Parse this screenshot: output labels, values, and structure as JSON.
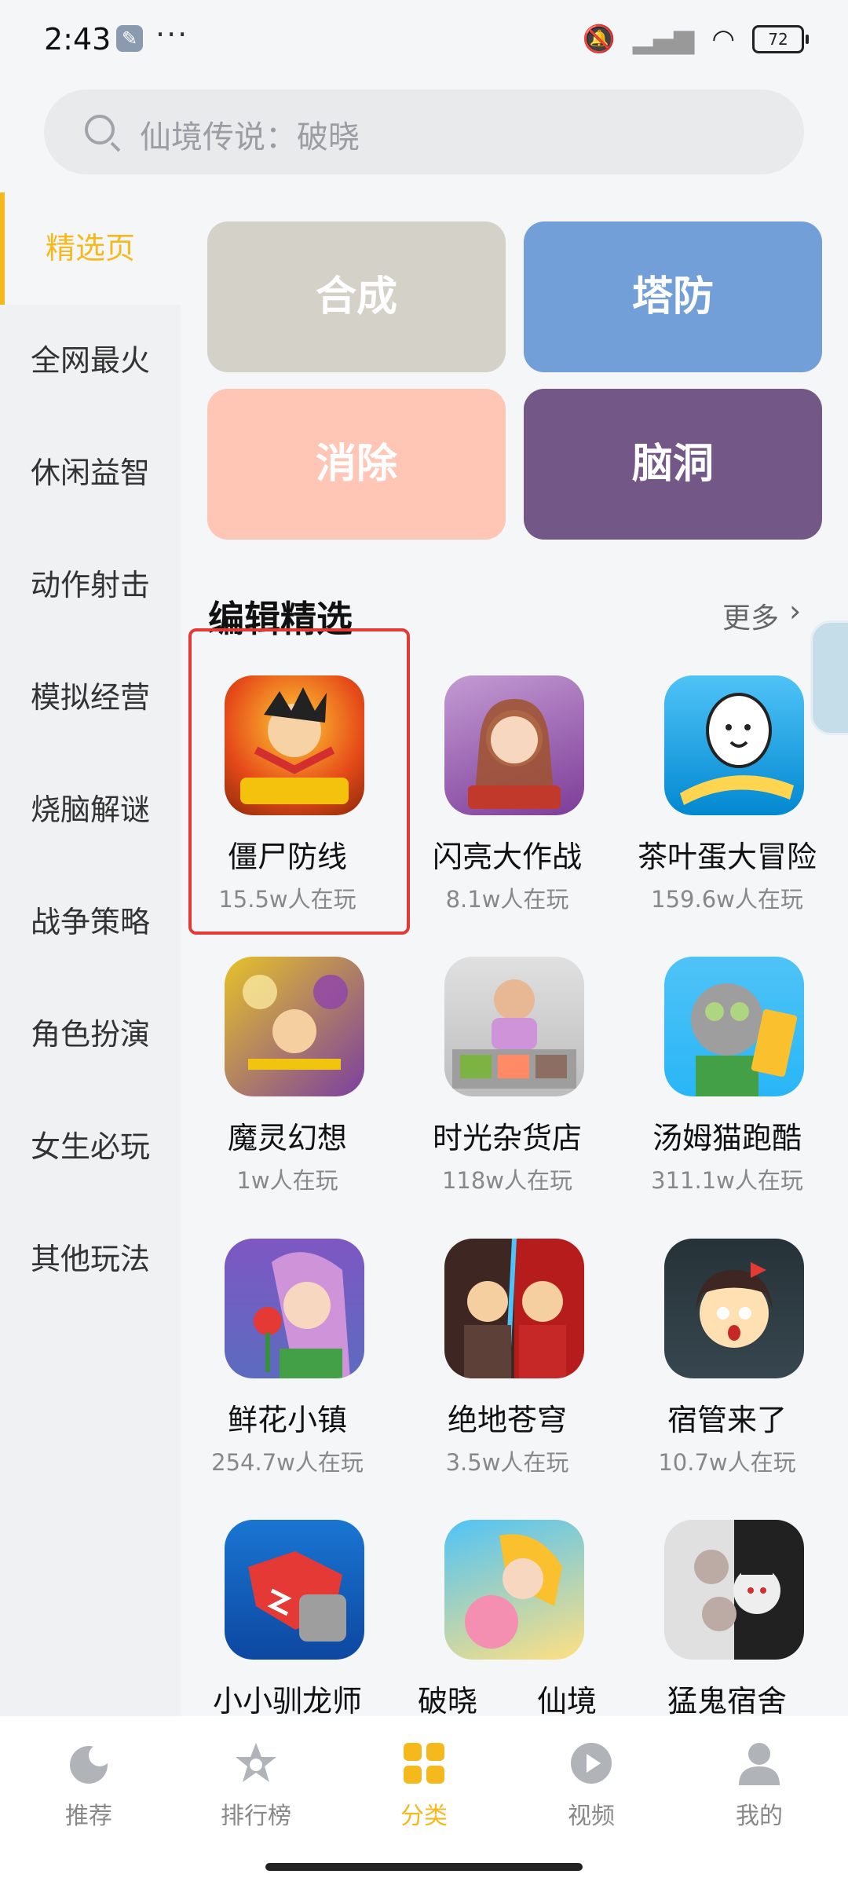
{
  "status": {
    "time": "2:43",
    "battery": "72"
  },
  "search": {
    "placeholder": "仙境传说：破晓"
  },
  "sidebar": {
    "items": [
      {
        "label": "精选页"
      },
      {
        "label": "全网最火"
      },
      {
        "label": "休闲益智"
      },
      {
        "label": "动作射击"
      },
      {
        "label": "模拟经营"
      },
      {
        "label": "烧脑解谜"
      },
      {
        "label": "战争策略"
      },
      {
        "label": "角色扮演"
      },
      {
        "label": "女生必玩"
      },
      {
        "label": "其他玩法"
      }
    ]
  },
  "categories": [
    {
      "label": "合成",
      "color": "#d4d1c8"
    },
    {
      "label": "塔防",
      "color": "#739fd8"
    },
    {
      "label": "消除",
      "color": "#ffc5b5"
    },
    {
      "label": "脑洞",
      "color": "#735887"
    }
  ],
  "section": {
    "title": "编辑精选",
    "more": "更多"
  },
  "games": [
    {
      "name": "僵尸防线",
      "players": "15.5w人在玩"
    },
    {
      "name": "闪亮大作战",
      "players": "8.1w人在玩"
    },
    {
      "name": "茶叶蛋大冒险",
      "players": "159.6w人在玩"
    },
    {
      "name": "魔灵幻想",
      "players": "1w人在玩"
    },
    {
      "name": "时光杂货店",
      "players": "118w人在玩"
    },
    {
      "name": "汤姆猫跑酷",
      "players": "311.1w人在玩"
    },
    {
      "name": "鲜花小镇",
      "players": "254.7w人在玩"
    },
    {
      "name": "绝地苍穹",
      "players": "3.5w人在玩"
    },
    {
      "name": "宿管来了",
      "players": "10.7w人在玩"
    },
    {
      "name": "小小驯龙师",
      "players": ""
    },
    {
      "name": "破晓　　仙境",
      "players": ""
    },
    {
      "name": "猛鬼宿舍",
      "players": ""
    }
  ],
  "tabs": [
    {
      "label": "推荐"
    },
    {
      "label": "排行榜"
    },
    {
      "label": "分类"
    },
    {
      "label": "视频"
    },
    {
      "label": "我的"
    }
  ],
  "colors": {
    "accent": "#f5b91d",
    "highlight": "#e53935"
  }
}
